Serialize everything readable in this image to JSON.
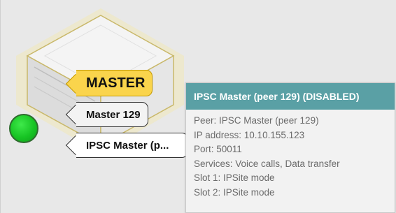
{
  "node": {
    "status_color": "#17c424",
    "labels": {
      "role": "MASTER",
      "name": "Master 129",
      "peer": "IPSC Master (p..."
    }
  },
  "tooltip": {
    "header_color": "#5aa0a5",
    "title": "IPSC Master (peer 129) (DISABLED)",
    "lines": {
      "peer": "Peer: IPSC Master (peer 129)",
      "ip": "IP address: 10.10.155.123",
      "port": "Port: 50011",
      "services": "Services: Voice calls, Data transfer",
      "slot1": "Slot 1: IPSite mode",
      "slot2": "Slot 2: IPSite mode"
    }
  }
}
